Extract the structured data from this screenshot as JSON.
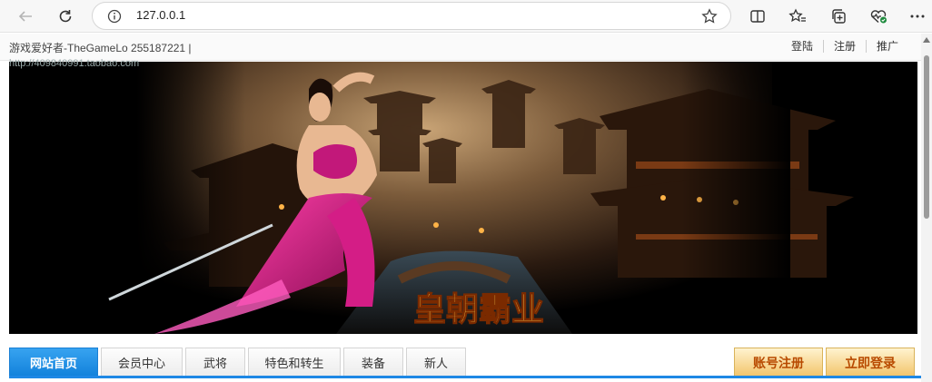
{
  "browser": {
    "url": "127.0.0.1"
  },
  "header": {
    "site_title": "游戏爱好者-TheGameLo 255187221 |",
    "site_url": "http://409840991.taobao.com",
    "links": [
      "登陆",
      "注册",
      "推广"
    ]
  },
  "banner": {
    "logo_text": "皇朝霸业"
  },
  "nav": {
    "tabs": [
      "网站首页",
      "会员中心",
      "武将",
      "特色和转生",
      "装备",
      "新人"
    ],
    "register_button": "账号注册",
    "login_button": "立即登录"
  },
  "colors": {
    "nav_active": "#1e88e5",
    "button_text": "#b84a00"
  }
}
